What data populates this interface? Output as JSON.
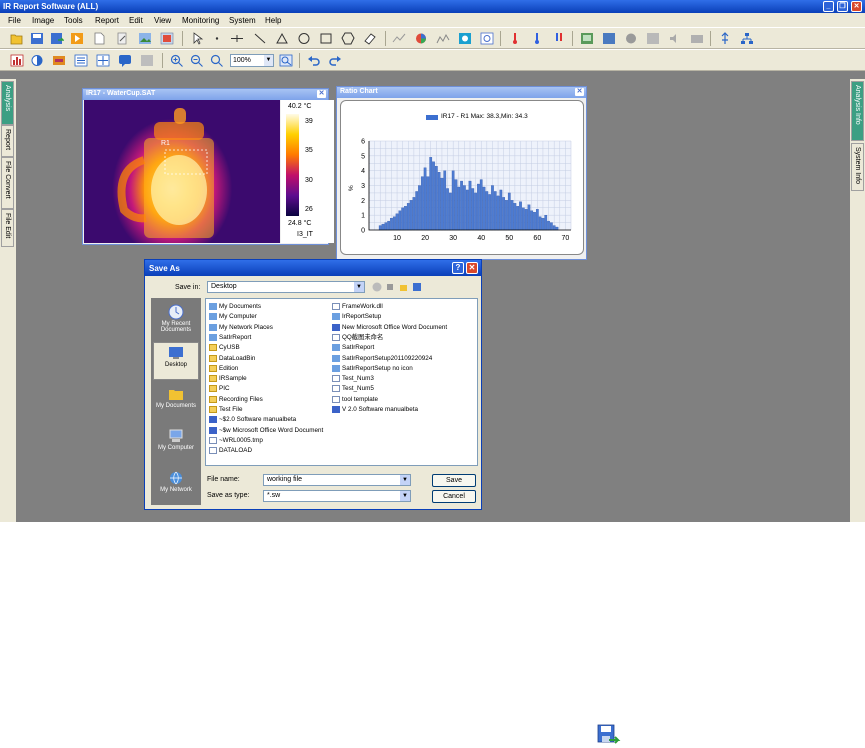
{
  "app": {
    "title": "IR Report Software (ALL)",
    "window_buttons": [
      "_",
      "❐",
      "✕"
    ]
  },
  "menu": [
    "File",
    "Image",
    "Tools",
    "Report",
    "Edit",
    "View",
    "Monitoring",
    "System",
    "Help"
  ],
  "toolbar": {
    "zoom_value": "100%"
  },
  "left_tabs": [
    "Analysis",
    "Report",
    "File Convert",
    "File Edit"
  ],
  "right_tabs": [
    "Analysis Info",
    "System Info"
  ],
  "thermal_window": {
    "title": "IR17 - WaterCup.SAT",
    "close": "✕",
    "region_label": "R1",
    "scale_max": "40.2 °C",
    "scale_min": "24.8 °C",
    "scale_ticks": [
      "39",
      "35",
      "30",
      "26"
    ],
    "palette_name": "I3_IT"
  },
  "ratio_window": {
    "title": "Ratio Chart",
    "close": "✕"
  },
  "chart_data": {
    "type": "bar",
    "legend": "IR17 - R1 Max: 38.3,Min: 34.3",
    "ylabel": "%",
    "ylim": [
      0,
      6
    ],
    "yticks": [
      0,
      1,
      2,
      3,
      4,
      5,
      6
    ],
    "xlim": [
      0,
      72
    ],
    "xticks": [
      10,
      20,
      30,
      40,
      50,
      60,
      70
    ],
    "x": [
      4,
      5,
      6,
      7,
      8,
      9,
      10,
      11,
      12,
      13,
      14,
      15,
      16,
      17,
      18,
      19,
      20,
      21,
      22,
      23,
      24,
      25,
      26,
      27,
      28,
      29,
      30,
      31,
      32,
      33,
      34,
      35,
      36,
      37,
      38,
      39,
      40,
      41,
      42,
      43,
      44,
      45,
      46,
      47,
      48,
      49,
      50,
      51,
      52,
      53,
      54,
      55,
      56,
      57,
      58,
      59,
      60,
      61,
      62,
      63,
      64,
      65,
      66,
      67
    ],
    "values": [
      0.3,
      0.4,
      0.5,
      0.6,
      0.8,
      0.9,
      1.1,
      1.3,
      1.5,
      1.6,
      1.8,
      2.0,
      2.2,
      2.6,
      3.0,
      3.6,
      4.2,
      3.6,
      4.9,
      4.6,
      4.3,
      3.9,
      3.5,
      4.0,
      2.8,
      2.5,
      4.0,
      3.4,
      2.9,
      3.3,
      3.0,
      2.7,
      3.3,
      2.8,
      2.5,
      3.1,
      3.4,
      2.9,
      2.6,
      2.4,
      3.0,
      2.6,
      2.3,
      2.7,
      2.2,
      2.0,
      2.5,
      2.0,
      1.8,
      1.6,
      1.9,
      1.5,
      1.4,
      1.7,
      1.3,
      1.2,
      1.4,
      0.9,
      0.8,
      1.0,
      0.6,
      0.5,
      0.3,
      0.2
    ]
  },
  "save_dialog": {
    "title": "Save As",
    "help_btn": "?",
    "close_btn": "✕",
    "save_in_label": "Save in:",
    "save_in_value": "Desktop",
    "places": [
      "My Recent Documents",
      "Desktop",
      "My Documents",
      "My Computer",
      "My Network"
    ],
    "files_col1": [
      {
        "name": "My Documents",
        "kind": "sys"
      },
      {
        "name": "My Computer",
        "kind": "sys"
      },
      {
        "name": "My Network Places",
        "kind": "sys"
      },
      {
        "name": "SatIrReport",
        "kind": "sys"
      },
      {
        "name": "CyUSB",
        "kind": "folder"
      },
      {
        "name": "DataLoadBin",
        "kind": "folder"
      },
      {
        "name": "Edition",
        "kind": "folder"
      },
      {
        "name": "IRSample",
        "kind": "folder"
      },
      {
        "name": "PIC",
        "kind": "folder"
      },
      {
        "name": "Recording Files",
        "kind": "folder"
      },
      {
        "name": "Test File",
        "kind": "folder"
      },
      {
        "name": "~$2.0 Software manualbeta",
        "kind": "word"
      },
      {
        "name": "~$w Microsoft Office Word Document",
        "kind": "word"
      },
      {
        "name": "~WRL0005.tmp",
        "kind": "doc"
      },
      {
        "name": "DATALOAD",
        "kind": "doc"
      }
    ],
    "files_col2": [
      {
        "name": "FrameWork.dll",
        "kind": "doc"
      },
      {
        "name": "IrReportSetup",
        "kind": "sys"
      },
      {
        "name": "New Microsoft Office Word Document",
        "kind": "word"
      },
      {
        "name": "QQ截图未命名",
        "kind": "doc"
      },
      {
        "name": "SatIrReport",
        "kind": "sys"
      },
      {
        "name": "SatIrReportSetup201109220924",
        "kind": "sys"
      },
      {
        "name": "SatIrReportSetup no icon",
        "kind": "sys"
      },
      {
        "name": "Test_Num3",
        "kind": "doc"
      },
      {
        "name": "Test_Num5",
        "kind": "doc"
      },
      {
        "name": "tool template",
        "kind": "doc"
      },
      {
        "name": "V 2.0 Software manualbeta",
        "kind": "word"
      }
    ],
    "file_name_label": "File name:",
    "file_name_value": "working file",
    "save_as_type_label": "Save as type:",
    "save_as_type_value": "*.sw",
    "save_button": "Save",
    "cancel_button": "Cancel"
  }
}
